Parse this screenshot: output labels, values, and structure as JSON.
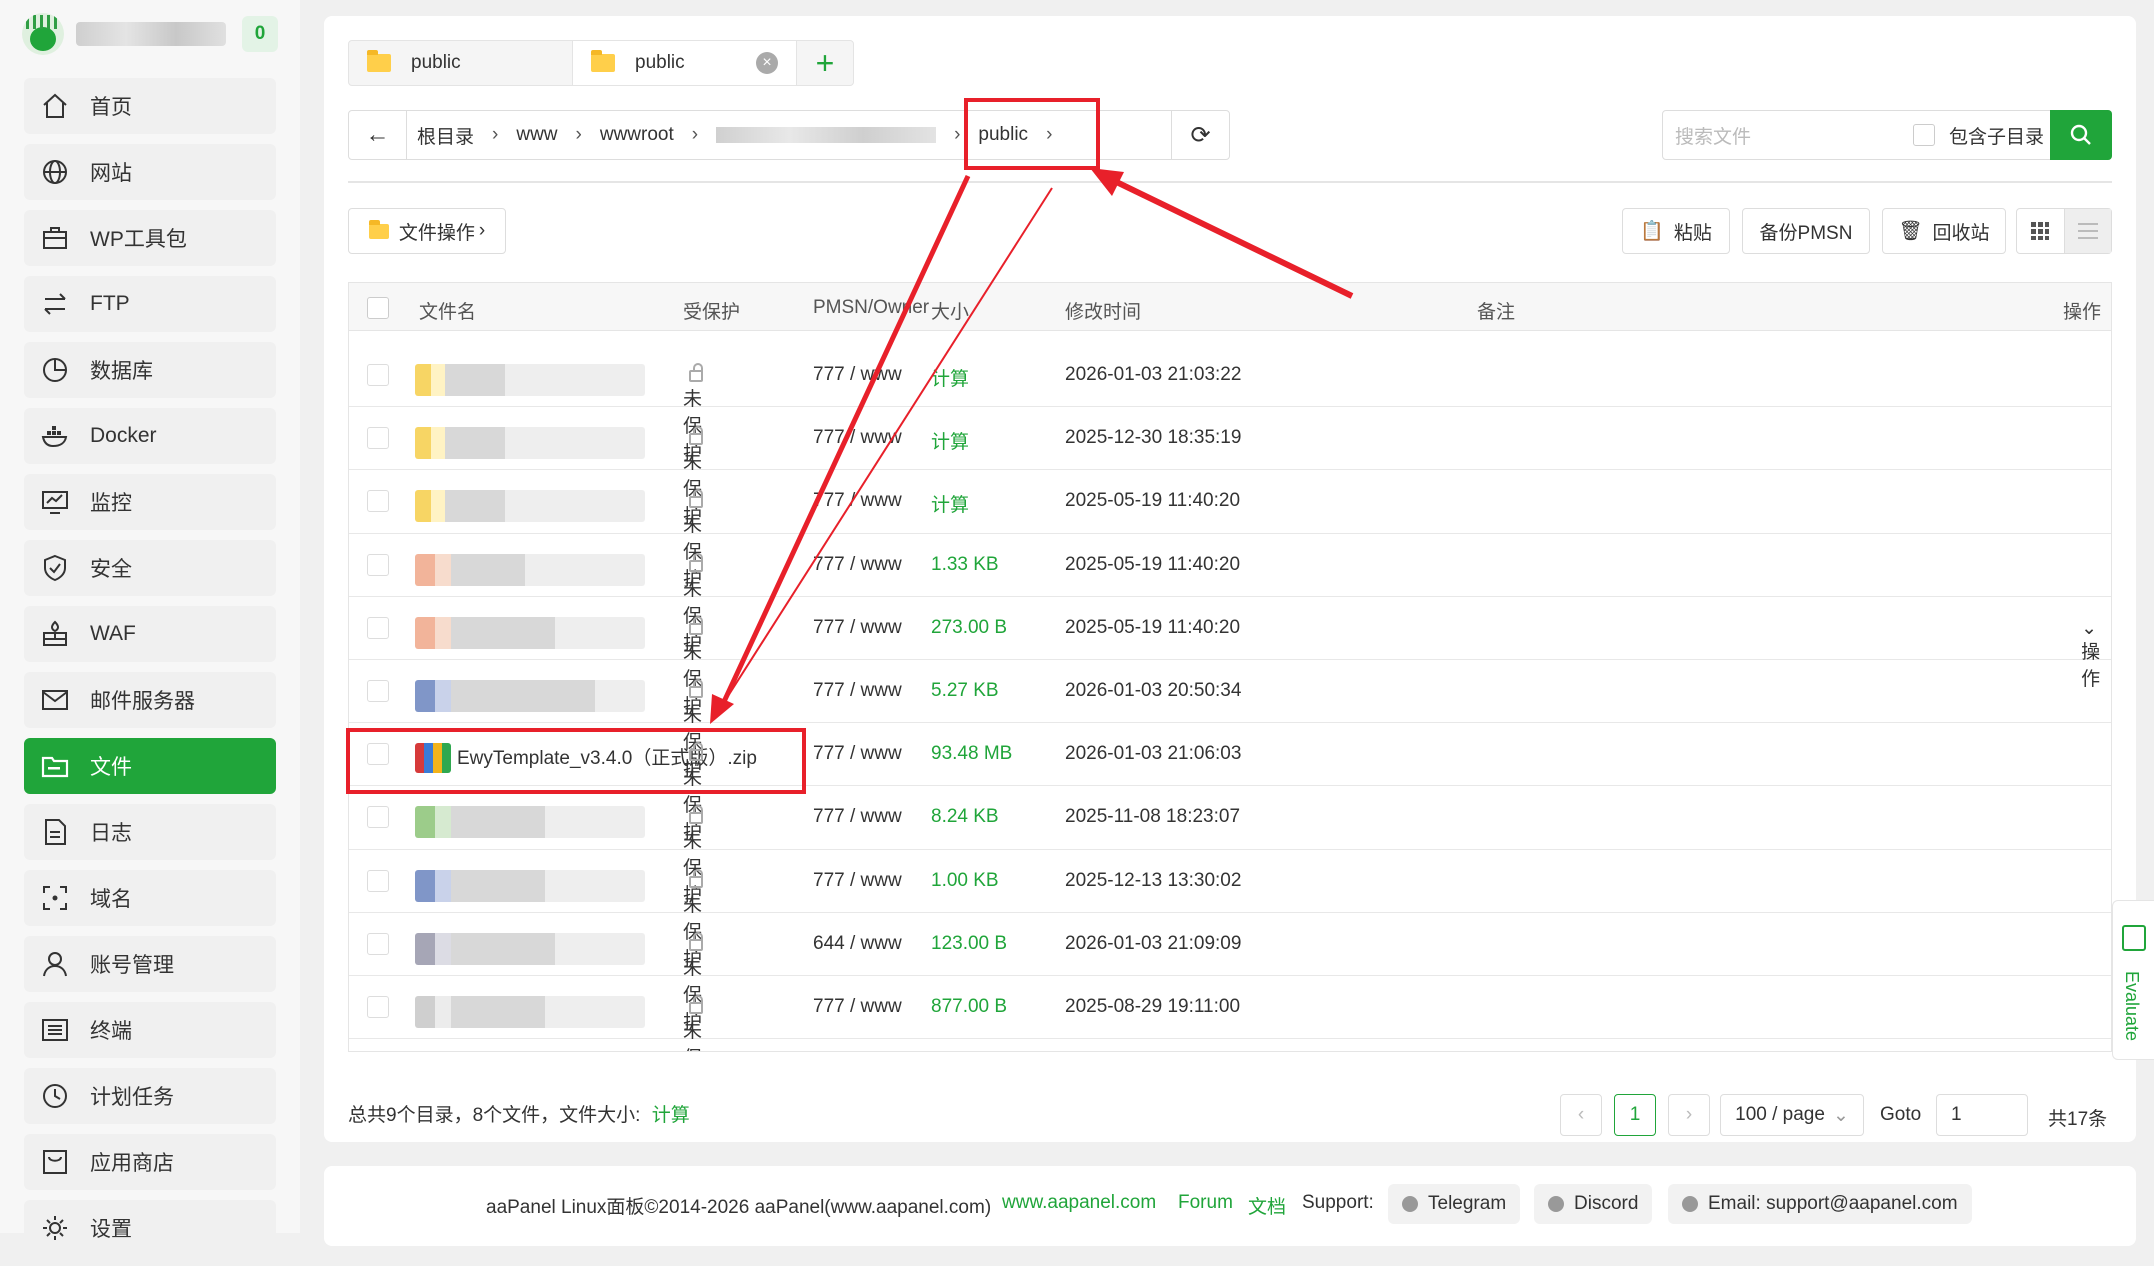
{
  "sidebar": {
    "badge": "0",
    "items": [
      {
        "label": "首页",
        "icon": "home-icon"
      },
      {
        "label": "网站",
        "icon": "globe-icon"
      },
      {
        "label": "WP工具包",
        "icon": "toolbox-icon"
      },
      {
        "label": "FTP",
        "icon": "transfer-icon"
      },
      {
        "label": "数据库",
        "icon": "database-icon"
      },
      {
        "label": "Docker",
        "icon": "docker-icon"
      },
      {
        "label": "监控",
        "icon": "monitor-icon"
      },
      {
        "label": "安全",
        "icon": "shield-icon"
      },
      {
        "label": "WAF",
        "icon": "firewall-icon"
      },
      {
        "label": "邮件服务器",
        "icon": "mail-icon"
      },
      {
        "label": "文件",
        "icon": "folder-icon",
        "active": true
      },
      {
        "label": "日志",
        "icon": "log-icon"
      },
      {
        "label": "域名",
        "icon": "domain-icon"
      },
      {
        "label": "账号管理",
        "icon": "user-icon"
      },
      {
        "label": "终端",
        "icon": "terminal-icon"
      },
      {
        "label": "计划任务",
        "icon": "clock-icon"
      },
      {
        "label": "应用商店",
        "icon": "store-icon"
      },
      {
        "label": "设置",
        "icon": "gear-icon"
      }
    ]
  },
  "tabs": [
    {
      "label": "public"
    },
    {
      "label": "public"
    }
  ],
  "breadcrumb": [
    "根目录",
    "www",
    "wwwroot",
    "public"
  ],
  "search": {
    "placeholder": "搜索文件",
    "include_sub": "包含子目录"
  },
  "toolbar": {
    "file_ops": "文件操作",
    "paste": "粘贴",
    "backup": "备份PMSN",
    "recycle": "回收站"
  },
  "table": {
    "headers": {
      "name": "文件名",
      "protect": "受保护",
      "perm": "PMSN/Owner",
      "size": "大小",
      "mtime": "修改时间",
      "remark": "备注",
      "ops": "操作"
    },
    "rows": [
      {
        "name": "",
        "protect": "未保护",
        "perm": "777 / www",
        "size": "计算",
        "mtime": "2026-01-03 21:03:22"
      },
      {
        "name": "",
        "protect": "未保护",
        "perm": "777 / www",
        "size": "计算",
        "mtime": "2025-12-30 18:35:19"
      },
      {
        "name": "",
        "protect": "未保护",
        "perm": "777 / www",
        "size": "计算",
        "mtime": "2025-05-19 11:40:20"
      },
      {
        "name": "",
        "protect": "未保护",
        "perm": "777 / www",
        "size": "1.33 KB",
        "mtime": "2025-05-19 11:40:20"
      },
      {
        "name": "",
        "protect": "未保护",
        "perm": "777 / www",
        "size": "273.00 B",
        "mtime": "2025-05-19 11:40:20",
        "ops": "操作"
      },
      {
        "name": "",
        "protect": "未保护",
        "perm": "777 / www",
        "size": "5.27 KB",
        "mtime": "2026-01-03 20:50:34"
      },
      {
        "name": "EwyTemplate_v3.4.0（正式版）.zip",
        "protect": "未保护",
        "perm": "777 / www",
        "size": "93.48 MB",
        "mtime": "2026-01-03 21:06:03"
      },
      {
        "name": "",
        "protect": "未保护",
        "perm": "777 / www",
        "size": "8.24 KB",
        "mtime": "2025-11-08 18:23:07"
      },
      {
        "name": "",
        "protect": "未保护",
        "perm": "777 / www",
        "size": "1.00 KB",
        "mtime": "2025-12-13 13:30:02"
      },
      {
        "name": "",
        "protect": "未保护",
        "perm": "644 / www",
        "size": "123.00 B",
        "mtime": "2026-01-03 21:09:09"
      },
      {
        "name": "",
        "protect": "未保护",
        "perm": "777 / www",
        "size": "877.00 B",
        "mtime": "2025-08-29 19:11:00"
      }
    ]
  },
  "summary": {
    "text": "总共9个目录，8个文件，文件大小:",
    "calc": "计算"
  },
  "pagination": {
    "page": "1",
    "per_page": "100 / page",
    "goto_label": "Goto",
    "goto_value": "1",
    "total": "共17条"
  },
  "footer": {
    "copyright": "aaPanel Linux面板©2014-2026 aaPanel(www.aapanel.com)",
    "site": "www.aapanel.com",
    "forum": "Forum",
    "docs": "文档",
    "support": "Support:",
    "telegram": "Telegram",
    "discord": "Discord",
    "email": "Email: support@aapanel.com"
  },
  "evaluate": "Evaluate",
  "colors": {
    "accent": "#20a53a",
    "annotation": "#e8202a"
  }
}
